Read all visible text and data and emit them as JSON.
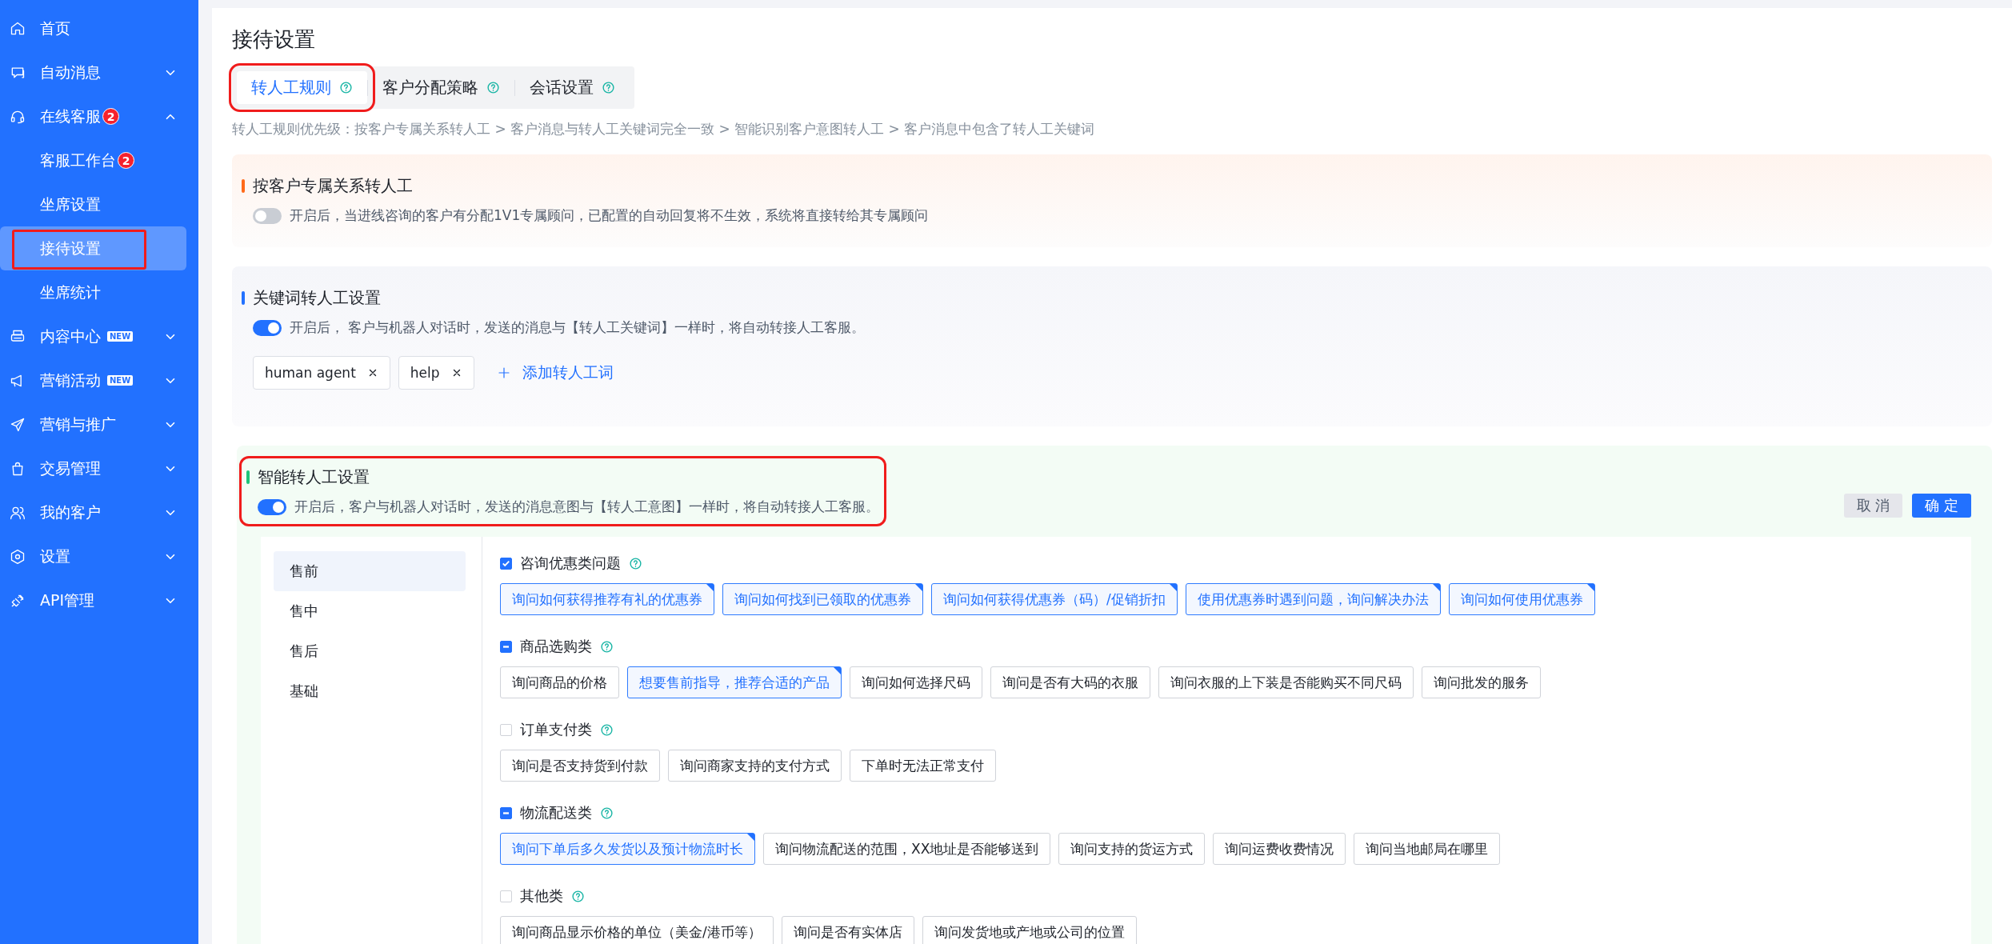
{
  "sidebar": {
    "items": [
      {
        "label": "首页",
        "kind": "link"
      },
      {
        "label": "自动消息",
        "kind": "group",
        "expanded": false
      },
      {
        "label": "在线客服",
        "kind": "group",
        "badge": "2",
        "expanded": true,
        "children": [
          {
            "label": "客服工作台",
            "badge": "2",
            "selected": false
          },
          {
            "label": "坐席设置",
            "selected": false
          },
          {
            "label": "接待设置",
            "selected": true,
            "highlighted": true
          },
          {
            "label": "坐席统计",
            "selected": false
          }
        ]
      },
      {
        "label": "内容中心",
        "kind": "group",
        "tag": "NEW",
        "expanded": false
      },
      {
        "label": "营销活动",
        "kind": "group",
        "tag": "NEW",
        "expanded": false
      },
      {
        "label": "营销与推广",
        "kind": "group",
        "expanded": false
      },
      {
        "label": "交易管理",
        "kind": "group",
        "expanded": false
      },
      {
        "label": "我的客户",
        "kind": "group",
        "expanded": false
      },
      {
        "label": "设置",
        "kind": "group",
        "expanded": false
      },
      {
        "label": "API管理",
        "kind": "group",
        "expanded": false
      }
    ]
  },
  "page": {
    "title": "接待设置"
  },
  "tabs": [
    {
      "label": "转人工规则",
      "selected": true,
      "highlighted": true
    },
    {
      "label": "客户分配策略",
      "selected": false,
      "highlighted": false
    },
    {
      "label": "会话设置",
      "selected": false,
      "highlighted": false
    }
  ],
  "priority_note": "转人工规则优先级：按客户专属关系转人工 > 客户消息与转人工关键词完全一致 > 智能识别客户意图转人工 > 客户消息中包含了转人工关键词",
  "sections": [
    {
      "kind": "basic",
      "title": "按客户专属关系转人工",
      "color": "#ff6a1a",
      "on": false,
      "highlighted": false,
      "description": "开启后，当进线咨询的客户有分配1V1专属顾问，已配置的自动回复将不生效，系统将直接转给其专属顾问"
    },
    {
      "kind": "keywords",
      "title": "关键词转人工设置",
      "color": "#2271ff",
      "on": true,
      "highlighted": false,
      "description": "开启后， 客户与机器人对话时，发送的消息与【转人工关键词】一样时，将自动转接人工客服。",
      "keywords": [
        "human agent",
        "help"
      ],
      "add_label": "添加转人工词"
    },
    {
      "kind": "intent",
      "title": "智能转人工设置",
      "color": "#1ec47a",
      "on": true,
      "highlighted": true,
      "description": "开启后，客户与机器人对话时，发送的消息意图与【转人工意图】一样时，将自动转接人工客服。",
      "buttons": [
        {
          "label": "取 消",
          "kind": "secondary"
        },
        {
          "label": "确 定",
          "kind": "primary"
        }
      ],
      "categories": [
        {
          "label": "售前",
          "selected": true
        },
        {
          "label": "售中",
          "selected": false
        },
        {
          "label": "售后",
          "selected": false
        },
        {
          "label": "基础",
          "selected": false
        }
      ],
      "groups": [
        {
          "title": "咨询优惠类问题",
          "checked": true,
          "partial": false,
          "options": [
            {
              "label": "询问如何获得推荐有礼的优惠券",
              "selected": true
            },
            {
              "label": "询问如何找到已领取的优惠券",
              "selected": true
            },
            {
              "label": "询问如何获得优惠券（码）/促销折扣",
              "selected": true
            },
            {
              "label": "使用优惠券时遇到问题，询问解决办法",
              "selected": true
            },
            {
              "label": "询问如何使用优惠券",
              "selected": true
            }
          ]
        },
        {
          "title": "商品选购类",
          "checked": false,
          "partial": true,
          "options": [
            {
              "label": "询问商品的价格",
              "selected": false
            },
            {
              "label": "想要售前指导，推荐合适的产品",
              "selected": true
            },
            {
              "label": "询问如何选择尺码",
              "selected": false
            },
            {
              "label": "询问是否有大码的衣服",
              "selected": false
            },
            {
              "label": "询问衣服的上下装是否能购买不同尺码",
              "selected": false
            },
            {
              "label": "询问批发的服务",
              "selected": false
            }
          ]
        },
        {
          "title": "订单支付类",
          "checked": false,
          "partial": false,
          "options": [
            {
              "label": "询问是否支持货到付款",
              "selected": false
            },
            {
              "label": "询问商家支持的支付方式",
              "selected": false
            },
            {
              "label": "下单时无法正常支付",
              "selected": false
            }
          ]
        },
        {
          "title": "物流配送类",
          "checked": false,
          "partial": true,
          "options": [
            {
              "label": "询问下单后多久发货以及预计物流时长",
              "selected": true
            },
            {
              "label": "询问物流配送的范围，XX地址是否能够送到",
              "selected": false
            },
            {
              "label": "询问支持的货运方式",
              "selected": false
            },
            {
              "label": "询问运费收费情况",
              "selected": false
            },
            {
              "label": "询问当地邮局在哪里",
              "selected": false
            }
          ]
        },
        {
          "title": "其他类",
          "checked": false,
          "partial": false,
          "options": [
            {
              "label": "询问商品显示价格的单位（美金/港币等）",
              "selected": false
            },
            {
              "label": "询问是否有实体店",
              "selected": false
            },
            {
              "label": "询问发货地或产地或公司的位置",
              "selected": false
            }
          ]
        }
      ]
    }
  ]
}
